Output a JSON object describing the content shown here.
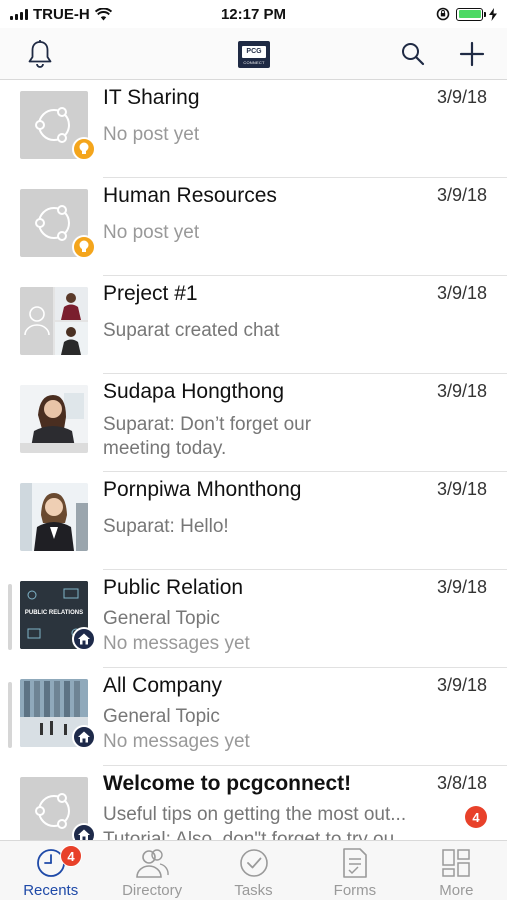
{
  "status_bar": {
    "carrier": "TRUE-H",
    "time": "12:17 PM"
  },
  "nav_bar": {
    "logo_text": "PCG",
    "logo_subtext": "CONNECT"
  },
  "chats": [
    {
      "name": "IT Sharing",
      "date": "3/9/18",
      "line1": "No post yet",
      "line2": ""
    },
    {
      "name": "Human Resources",
      "date": "3/9/18",
      "line1": "No post yet",
      "line2": ""
    },
    {
      "name": "Preject #1",
      "date": "3/9/18",
      "line1": "Suparat created chat",
      "line2": ""
    },
    {
      "name": "Sudapa Hongthong",
      "date": "3/9/18",
      "line1": "Suparat: Don’t forget our",
      "line2": "meeting today."
    },
    {
      "name": "Pornpiwa Mhonthong",
      "date": "3/9/18",
      "line1": "Suparat: Hello!",
      "line2": ""
    },
    {
      "name": "Public Relation",
      "date": "3/9/18",
      "line1": "General Topic",
      "line2": "No messages yet"
    },
    {
      "name": "All Company",
      "date": "3/9/18",
      "line1": "General Topic",
      "line2": "No messages yet"
    },
    {
      "name": "Welcome to pcgconnect!",
      "date": "3/8/18",
      "line1": "Useful tips on getting the most out...",
      "line2": "Tutorial: Also, don\"t forget to try ou...",
      "unread": "4"
    }
  ],
  "avatar_text": {
    "public_relation": "PUBLIC RELATIONS"
  },
  "tabs": [
    {
      "label": "Recents",
      "badge": "4"
    },
    {
      "label": "Directory"
    },
    {
      "label": "Tasks"
    },
    {
      "label": "Forms"
    },
    {
      "label": "More"
    }
  ],
  "colors": {
    "accent": "#1f4aa8",
    "badge": "#e8412a",
    "group_badge_yellow": "#f4a51c",
    "group_badge_navy": "#1e2a4a"
  },
  "icons": [
    "signal-icon",
    "wifi-icon",
    "orientation-lock-icon",
    "battery-icon",
    "charging-icon",
    "bell-icon",
    "search-icon",
    "plus-icon",
    "group-share-icon",
    "bulb-icon",
    "home-icon",
    "user-icon",
    "clock-icon",
    "people-icon",
    "check-circle-icon",
    "form-icon",
    "grid-icon"
  ]
}
